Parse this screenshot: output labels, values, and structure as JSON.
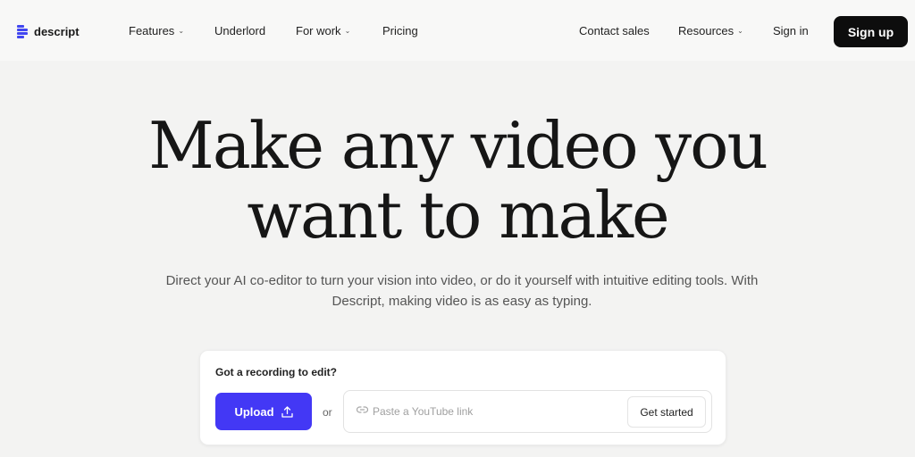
{
  "brand": {
    "name": "descript",
    "accent_color": "#4146f0"
  },
  "nav": {
    "items": [
      {
        "label": "Features",
        "has_dropdown": true
      },
      {
        "label": "Underlord",
        "has_dropdown": false
      },
      {
        "label": "For work",
        "has_dropdown": true
      },
      {
        "label": "Pricing",
        "has_dropdown": false
      }
    ],
    "right_items": [
      {
        "label": "Contact sales",
        "has_dropdown": false
      },
      {
        "label": "Resources",
        "has_dropdown": true
      },
      {
        "label": "Sign in",
        "has_dropdown": false
      }
    ],
    "signup_label": "Sign up"
  },
  "hero": {
    "headline_line1": "Make any video you",
    "headline_line2": "want to make",
    "subheadline_line1": "Direct your AI co-editor to turn your vision into video, or do it yourself with intuitive editing tools. With",
    "subheadline_line2": "Descript, making video is as easy as typing."
  },
  "upload_card": {
    "title": "Got a recording to edit?",
    "upload_label": "Upload",
    "upload_icon": "upload-icon",
    "upload_color": "#4338f5",
    "or_text": "or",
    "link_icon": "link-icon",
    "link_placeholder": "Paste a YouTube link",
    "link_value": "",
    "get_started_label": "Get started"
  }
}
